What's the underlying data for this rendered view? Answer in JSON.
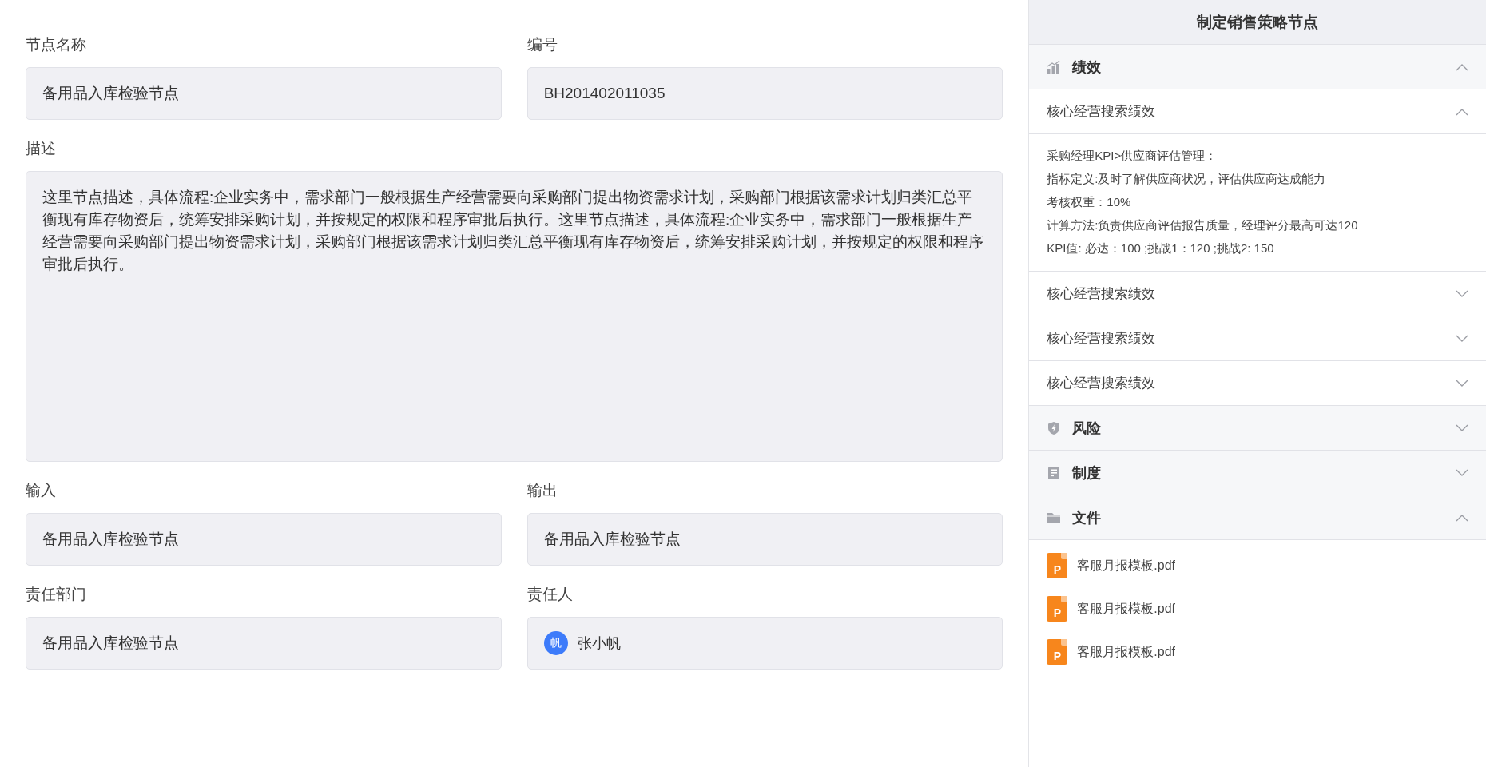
{
  "form": {
    "rows": [
      {
        "fields": [
          {
            "label": "节点名称",
            "kind": "text",
            "value": "备用品入库检验节点"
          },
          {
            "label": "编号",
            "kind": "text",
            "value": "BH201402011035"
          }
        ]
      },
      {
        "fields": [
          {
            "label": "描述",
            "kind": "textarea",
            "value": "这里节点描述，具体流程:企业实务中，需求部门一般根据生产经营需要向采购部门提出物资需求计划，采购部门根据该需求计划归类汇总平衡现有库存物资后，统筹安排采购计划，并按规定的权限和程序审批后执行。这里节点描述，具体流程:企业实务中，需求部门一般根据生产经营需要向采购部门提出物资需求计划，采购部门根据该需求计划归类汇总平衡现有库存物资后，统筹安排采购计划，并按规定的权限和程序审批后执行。"
          }
        ]
      },
      {
        "fields": [
          {
            "label": "输入",
            "kind": "text",
            "value": "备用品入库检验节点"
          },
          {
            "label": "输出",
            "kind": "text",
            "value": "备用品入库检验节点"
          }
        ]
      },
      {
        "fields": [
          {
            "label": "责任部门",
            "kind": "text",
            "value": "备用品入库检验节点"
          },
          {
            "label": "责任人",
            "kind": "person",
            "avatar": "帆",
            "value": "张小帆"
          }
        ]
      }
    ]
  },
  "panel": {
    "title": "制定销售策略节点",
    "sections": [
      {
        "title": "绩效",
        "expanded": true,
        "items": [
          {
            "title": "核心经营搜索绩效",
            "expanded": true,
            "lines": [
              "采购经理KPI>供应商评估管理：",
              "指标定义:及时了解供应商状况，评估供应商达成能力",
              "考核权重：10%",
              "计算方法:负责供应商评估报告质量，经理评分最高可达120",
              "KPI值: 必达：100 ;挑战1：120 ;挑战2: 150"
            ]
          },
          {
            "title": "核心经营搜索绩效",
            "expanded": false
          },
          {
            "title": "核心经营搜索绩效",
            "expanded": false
          },
          {
            "title": "核心经营搜索绩效",
            "expanded": false
          }
        ]
      },
      {
        "title": "风险",
        "expanded": false
      },
      {
        "title": "制度",
        "expanded": false
      },
      {
        "title": "文件",
        "expanded": true,
        "files": [
          {
            "name": "客服月报模板.pdf",
            "badge": "P"
          },
          {
            "name": "客服月报模板.pdf",
            "badge": "P"
          },
          {
            "name": "客服月报模板.pdf",
            "badge": "P"
          }
        ]
      }
    ]
  }
}
